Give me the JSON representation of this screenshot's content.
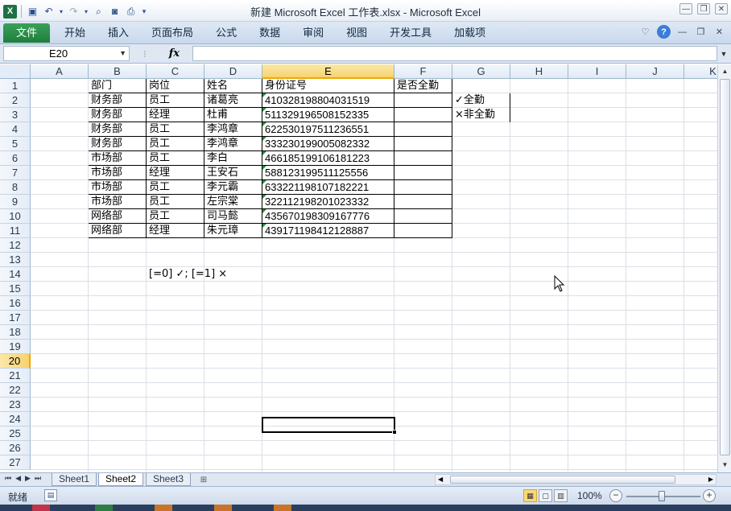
{
  "window": {
    "title": "新建 Microsoft Excel 工作表.xlsx  -  Microsoft Excel"
  },
  "quick_access": [
    "excel-icon",
    "save-icon",
    "undo-icon",
    "redo-icon",
    "preview-icon",
    "camera-icon",
    "print-preview-icon",
    "customize-icon"
  ],
  "ribbon": {
    "tabs": [
      "文件",
      "开始",
      "插入",
      "页面布局",
      "公式",
      "数据",
      "审阅",
      "视图",
      "开发工具",
      "加载项"
    ]
  },
  "formula_bar": {
    "name_box": "E20",
    "fx_label": "fx",
    "formula": ""
  },
  "columns": [
    "A",
    "B",
    "C",
    "D",
    "E",
    "F",
    "G",
    "H",
    "I",
    "J",
    "K"
  ],
  "rows": [
    "1",
    "2",
    "3",
    "4",
    "5",
    "6",
    "7",
    "8",
    "9",
    "10",
    "11",
    "12",
    "13",
    "14",
    "15",
    "16",
    "17",
    "18",
    "19",
    "20",
    "21",
    "22",
    "23",
    "24",
    "25",
    "26",
    "27"
  ],
  "table": {
    "headers": [
      "部门",
      "岗位",
      "姓名",
      "身份证号",
      "是否全勤"
    ],
    "rows": [
      [
        "财务部",
        "员工",
        "诸葛亮",
        "410328198804031519",
        ""
      ],
      [
        "财务部",
        "经理",
        "杜甫",
        "511329196508152335",
        ""
      ],
      [
        "财务部",
        "员工",
        "李鸿章",
        "622530197511236551",
        ""
      ],
      [
        "财务部",
        "员工",
        "李鸿章",
        "333230199005082332",
        ""
      ],
      [
        "市场部",
        "员工",
        "李白",
        "466185199106181223",
        ""
      ],
      [
        "市场部",
        "经理",
        "王安石",
        "588123199511125556",
        ""
      ],
      [
        "市场部",
        "员工",
        "李元霸",
        "633221198107182221",
        ""
      ],
      [
        "市场部",
        "员工",
        "左宗棠",
        "322112198201023332",
        ""
      ],
      [
        "网络部",
        "员工",
        "司马懿",
        "435670198309167776",
        ""
      ],
      [
        "网络部",
        "经理",
        "朱元璋",
        "439171198412128887",
        ""
      ]
    ]
  },
  "legend": [
    "✓全勤",
    "×非全勤"
  ],
  "format_note": "[=0] ✓; [=1] ×",
  "sheets": {
    "tabs": [
      "Sheet1",
      "Sheet2",
      "Sheet3"
    ],
    "active": "Sheet2"
  },
  "status": {
    "text": "就绪",
    "zoom": "100%"
  }
}
